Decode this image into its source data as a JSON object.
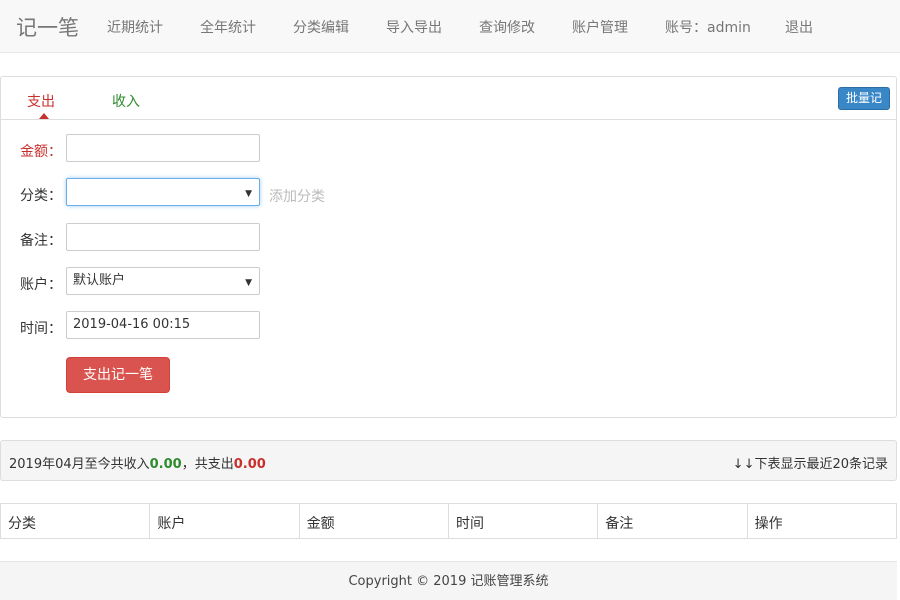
{
  "navbar": {
    "brand": "记一笔",
    "items": [
      {
        "label": "近期统计"
      },
      {
        "label": "全年统计"
      },
      {
        "label": "分类编辑"
      },
      {
        "label": "导入导出"
      },
      {
        "label": "查询修改"
      },
      {
        "label": "账户管理"
      },
      {
        "label": "账号：admin"
      },
      {
        "label": "退出"
      }
    ]
  },
  "tabs": {
    "expense": "支出",
    "income": "收入",
    "active": "支出",
    "batch_button": "批量记"
  },
  "form": {
    "amount_label": "金额：",
    "amount_value": "",
    "category_label": "分类：",
    "category_value": "",
    "add_category_link": "添加分类",
    "note_label": "备注：",
    "note_value": "",
    "account_label": "账户：",
    "account_value": "默认账户",
    "time_label": "时间：",
    "time_value": "2019-04-16 00:15",
    "submit_label": "支出记一笔"
  },
  "summary": {
    "prefix": "2019年04月至今共收入",
    "income": "0.00",
    "middle": "，共支出",
    "expense": "0.00",
    "note": "↓↓下表显示最近20条记录"
  },
  "table": {
    "columns": [
      "分类",
      "账户",
      "金额",
      "时间",
      "备注",
      "操作"
    ]
  },
  "footer": {
    "copyright": "Copyright © 2019 记账管理系统"
  },
  "colors": {
    "expense": "#c9302c",
    "income": "#2e8b2e",
    "primary": "#3a87c8",
    "danger": "#d9534f"
  }
}
